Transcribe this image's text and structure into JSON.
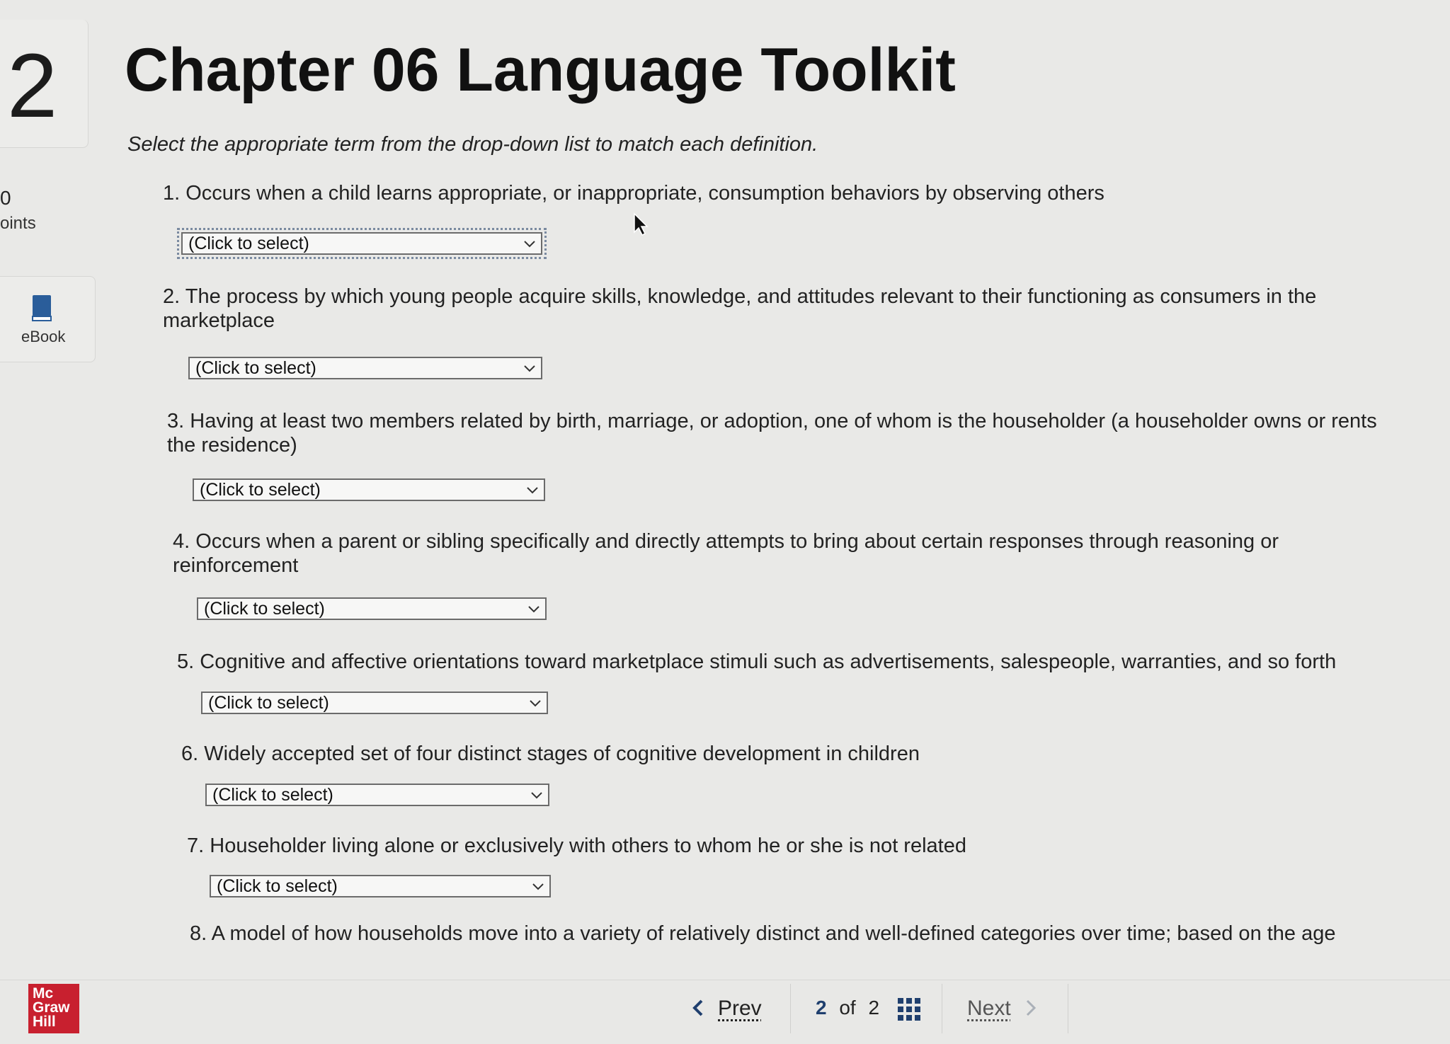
{
  "sidebar": {
    "question_number": "2",
    "points_value": "0",
    "points_label": "oints",
    "ebook_label": "eBook"
  },
  "header": {
    "title": "Chapter 06 Language Toolkit",
    "instruction": "Select the appropriate term from the drop-down list to match each definition."
  },
  "questions": [
    {
      "number": "1.",
      "text": "Occurs when a child learns appropriate, or inappropriate, consumption behaviors by observing others",
      "selected": "(Click to select)"
    },
    {
      "number": "2.",
      "text": "The process by which young people acquire skills, knowledge, and attitudes relevant to their functioning as consumers in the marketplace",
      "selected": "(Click to select)"
    },
    {
      "number": "3.",
      "text": "Having at least two members related by birth, marriage, or adoption, one of whom is the householder (a householder owns or rents the residence)",
      "selected": "(Click to select)"
    },
    {
      "number": "4.",
      "text": "Occurs when a parent or sibling specifically and directly attempts to bring about certain responses through reasoning or reinforcement",
      "selected": "(Click to select)"
    },
    {
      "number": "5.",
      "text": "Cognitive and affective orientations toward marketplace stimuli such as advertisements, salespeople, warranties, and so forth",
      "selected": "(Click to select)"
    },
    {
      "number": "6.",
      "text": "Widely accepted set of four distinct stages of cognitive development in children",
      "selected": "(Click to select)"
    },
    {
      "number": "7.",
      "text": "Householder living alone or exclusively with others to whom he or she is not related",
      "selected": "(Click to select)"
    },
    {
      "number": "8.",
      "text": "A model of how households move into a variety of relatively distinct and well-defined categories over time; based on the age"
    }
  ],
  "footer": {
    "logo_lines": [
      "Mc",
      "Graw",
      "Hill"
    ],
    "prev_label": "Prev",
    "page_current": "2",
    "page_of": "of",
    "page_total": "2",
    "next_label": "Next"
  },
  "colors": {
    "logo_red": "#c8202f",
    "ebook_blue": "#2a5d9a"
  }
}
